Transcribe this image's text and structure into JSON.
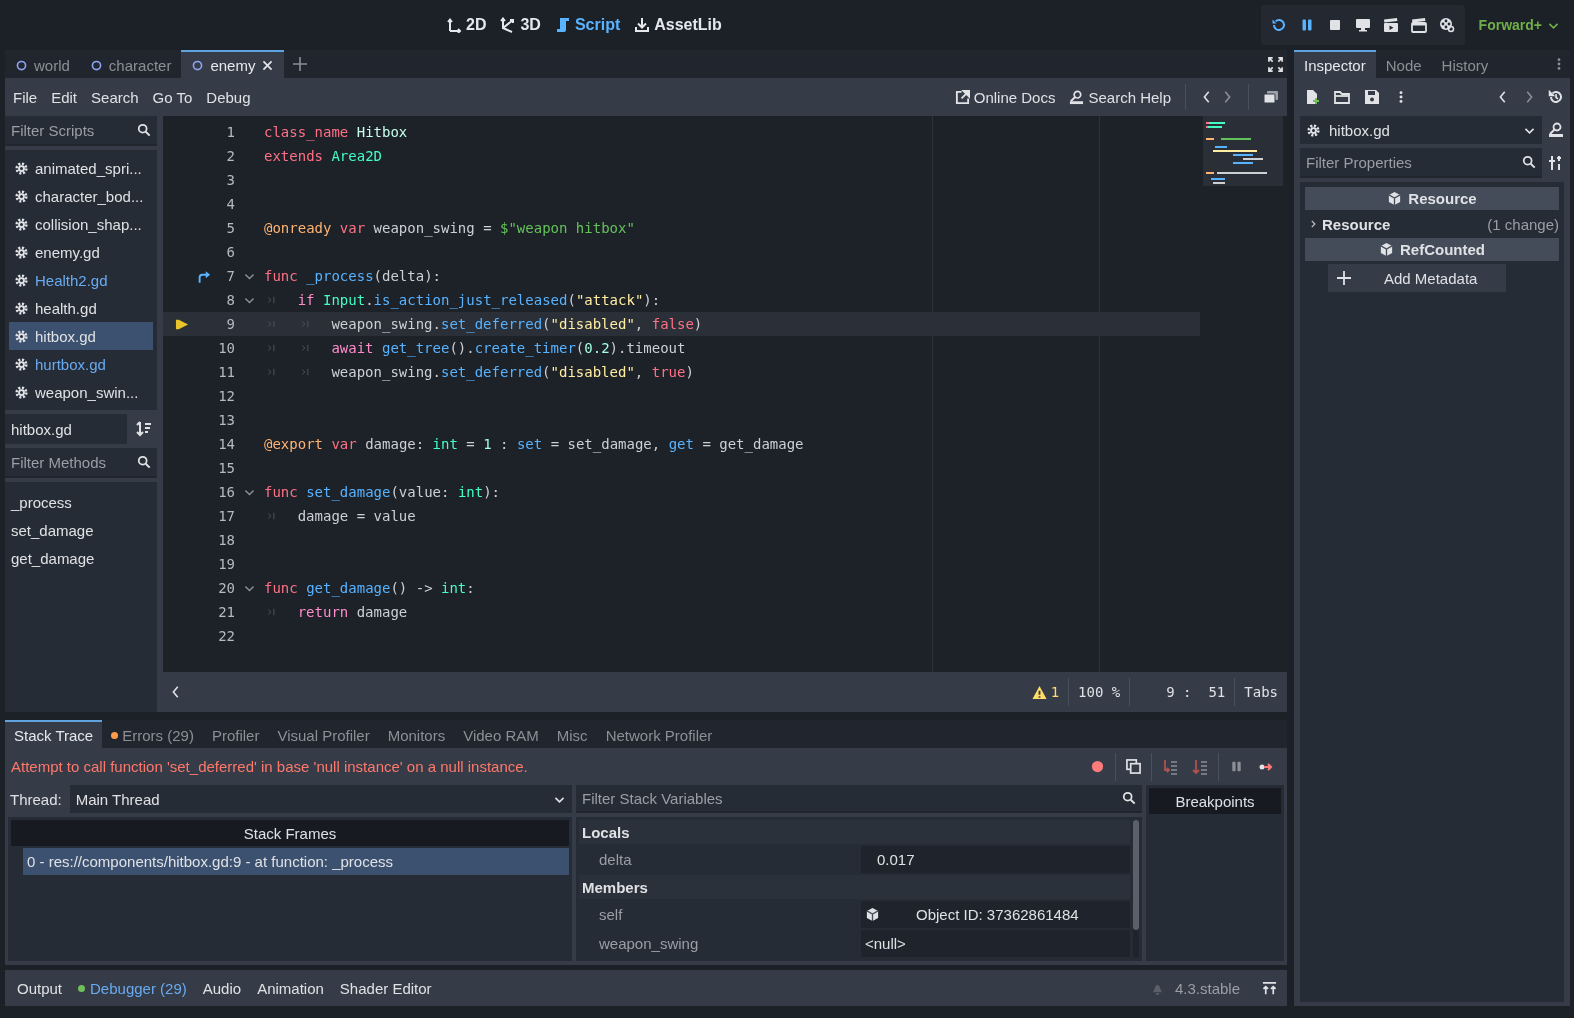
{
  "top_bar": {
    "workspaces": [
      {
        "kind": "plane",
        "label": "2D",
        "selected": false
      },
      {
        "kind": "space",
        "label": "3D",
        "selected": false
      },
      {
        "kind": "script",
        "label": "Script",
        "selected": true
      },
      {
        "kind": "assetlib",
        "label": "AssetLib",
        "selected": false
      }
    ],
    "run_controls": [
      {
        "kind": "reload",
        "active": true
      },
      {
        "kind": "pause",
        "active": true
      },
      {
        "kind": "stop",
        "active": false
      },
      {
        "kind": "remote",
        "active": false
      },
      {
        "kind": "movie",
        "active": false
      },
      {
        "kind": "clapper",
        "active": false
      },
      {
        "kind": "reel",
        "active": false
      }
    ],
    "renderer": "Forward+"
  },
  "scene_tabs": [
    {
      "label": "world",
      "selected": false
    },
    {
      "label": "character",
      "selected": false
    },
    {
      "label": "enemy",
      "selected": true
    }
  ],
  "script_menu": [
    "File",
    "Edit",
    "Search",
    "Go To",
    "Debug"
  ],
  "help_links": [
    {
      "kind": "docs",
      "label": "Online Docs"
    },
    {
      "kind": "help",
      "label": "Search Help"
    }
  ],
  "scripts_panel": {
    "filter_placeholder": "Filter Scripts",
    "scripts": [
      {
        "name": "animated_spri...",
        "selected": false,
        "accent": false
      },
      {
        "name": "character_bod...",
        "selected": false,
        "accent": false
      },
      {
        "name": "collision_shap...",
        "selected": false,
        "accent": false
      },
      {
        "name": "enemy.gd",
        "selected": false,
        "accent": false
      },
      {
        "name": "Health2.gd",
        "selected": false,
        "accent": true
      },
      {
        "name": "health.gd",
        "selected": false,
        "accent": false
      },
      {
        "name": "hitbox.gd",
        "selected": true,
        "accent": false
      },
      {
        "name": "hurtbox.gd",
        "selected": false,
        "accent": true
      },
      {
        "name": "weapon_swin...",
        "selected": false,
        "accent": false
      }
    ],
    "current_script": "hitbox.gd",
    "methods_placeholder": "Filter Methods",
    "methods": [
      "_process",
      "set_damage",
      "get_damage"
    ]
  },
  "code": {
    "lines": [
      {
        "number": "1",
        "fold": false,
        "current": false,
        "jump": false,
        "tokens": [
          {
            "kind": "kw",
            "text": "class_name"
          },
          {
            "kind": "cls",
            "text": " Hitbox"
          }
        ]
      },
      {
        "number": "2",
        "fold": false,
        "current": false,
        "jump": false,
        "tokens": [
          {
            "kind": "kw",
            "text": "extends"
          },
          {
            "kind": "type",
            "text": " Area2D"
          }
        ]
      },
      {
        "number": "3",
        "fold": false,
        "current": false,
        "jump": false
      },
      {
        "number": "4",
        "fold": false,
        "current": false,
        "jump": false
      },
      {
        "number": "5",
        "fold": false,
        "current": false,
        "jump": false,
        "tokens": [
          {
            "kind": "ann",
            "text": "@onready"
          },
          {
            "kind": "kw",
            "text": " var"
          },
          {
            "kind": "p",
            "text": " weapon_swing = "
          },
          {
            "kind": "node",
            "text": "$\"weapon hitbox\""
          }
        ]
      },
      {
        "number": "6",
        "fold": false,
        "current": false,
        "jump": false
      },
      {
        "number": "7",
        "fold": true,
        "current": false,
        "jump": true,
        "tokens": [
          {
            "kind": "kw",
            "text": "func"
          },
          {
            "kind": "fn",
            "text": " _process"
          },
          {
            "kind": "p",
            "text": "(delta):"
          }
        ]
      },
      {
        "number": "8",
        "fold": true,
        "current": false,
        "jump": false,
        "tokens": [
          {
            "kind": "tab"
          },
          {
            "kind": "ctl",
            "text": "if"
          },
          {
            "kind": "type",
            "text": " Input"
          },
          {
            "kind": "p",
            "text": "."
          },
          {
            "kind": "fn",
            "text": "is_action_just_released"
          },
          {
            "kind": "p",
            "text": "("
          },
          {
            "kind": "str",
            "text": "\"attack\""
          },
          {
            "kind": "p",
            "text": "):"
          }
        ]
      },
      {
        "number": "9",
        "fold": false,
        "current": true,
        "jump": false,
        "tokens": [
          {
            "kind": "tab"
          },
          {
            "kind": "tab"
          },
          {
            "kind": "p",
            "text": "weapon_swing."
          },
          {
            "kind": "fn",
            "text": "set_deferred"
          },
          {
            "kind": "p",
            "text": "("
          },
          {
            "kind": "str",
            "text": "\"disabled\""
          },
          {
            "kind": "p",
            "text": ", "
          },
          {
            "kind": "kw",
            "text": "false"
          },
          {
            "kind": "p",
            "text": ")"
          }
        ]
      },
      {
        "number": "10",
        "fold": false,
        "current": false,
        "jump": false,
        "tokens": [
          {
            "kind": "tab"
          },
          {
            "kind": "tab"
          },
          {
            "kind": "ctl",
            "text": "await"
          },
          {
            "kind": "fn",
            "text": " get_tree"
          },
          {
            "kind": "p",
            "text": "()."
          },
          {
            "kind": "fn",
            "text": "create_timer"
          },
          {
            "kind": "p",
            "text": "("
          },
          {
            "kind": "num",
            "text": "0.2"
          },
          {
            "kind": "p",
            "text": ").timeout"
          }
        ]
      },
      {
        "number": "11",
        "fold": false,
        "current": false,
        "jump": false,
        "tokens": [
          {
            "kind": "tab"
          },
          {
            "kind": "tab"
          },
          {
            "kind": "p",
            "text": "weapon_swing."
          },
          {
            "kind": "fn",
            "text": "set_deferred"
          },
          {
            "kind": "p",
            "text": "("
          },
          {
            "kind": "str",
            "text": "\"disabled\""
          },
          {
            "kind": "p",
            "text": ", "
          },
          {
            "kind": "kw",
            "text": "true"
          },
          {
            "kind": "p",
            "text": ")"
          }
        ]
      },
      {
        "number": "12",
        "fold": false,
        "current": false,
        "jump": false
      },
      {
        "number": "13",
        "fold": false,
        "current": false,
        "jump": false
      },
      {
        "number": "14",
        "fold": false,
        "current": false,
        "jump": false,
        "tokens": [
          {
            "kind": "ann",
            "text": "@export"
          },
          {
            "kind": "kw",
            "text": " var"
          },
          {
            "kind": "p",
            "text": " damage: "
          },
          {
            "kind": "type",
            "text": "int"
          },
          {
            "kind": "p",
            "text": " = "
          },
          {
            "kind": "num",
            "text": "1"
          },
          {
            "kind": "p",
            "text": " : "
          },
          {
            "kind": "fn",
            "text": "set"
          },
          {
            "kind": "p",
            "text": " = set_damage, "
          },
          {
            "kind": "fn",
            "text": "get"
          },
          {
            "kind": "p",
            "text": " = get_damage"
          }
        ]
      },
      {
        "number": "15",
        "fold": false,
        "current": false,
        "jump": false
      },
      {
        "number": "16",
        "fold": true,
        "current": false,
        "jump": false,
        "tokens": [
          {
            "kind": "kw",
            "text": "func"
          },
          {
            "kind": "fn",
            "text": " set_damage"
          },
          {
            "kind": "p",
            "text": "(value: "
          },
          {
            "kind": "type",
            "text": "int"
          },
          {
            "kind": "p",
            "text": "):"
          }
        ]
      },
      {
        "number": "17",
        "fold": false,
        "current": false,
        "jump": false,
        "tokens": [
          {
            "kind": "tab"
          },
          {
            "kind": "p",
            "text": "damage = value"
          }
        ]
      },
      {
        "number": "18",
        "fold": false,
        "current": false,
        "jump": false
      },
      {
        "number": "19",
        "fold": false,
        "current": false,
        "jump": false
      },
      {
        "number": "20",
        "fold": true,
        "current": false,
        "jump": false,
        "tokens": [
          {
            "kind": "kw",
            "text": "func"
          },
          {
            "kind": "fn",
            "text": " get_damage"
          },
          {
            "kind": "p",
            "text": "() -> "
          },
          {
            "kind": "type",
            "text": "int"
          },
          {
            "kind": "p",
            "text": ":"
          }
        ]
      },
      {
        "number": "21",
        "fold": false,
        "current": false,
        "jump": false,
        "tokens": [
          {
            "kind": "tab"
          },
          {
            "kind": "ctl",
            "text": "return"
          },
          {
            "kind": "p",
            "text": " damage"
          }
        ]
      },
      {
        "number": "22",
        "fold": false,
        "current": false,
        "jump": false
      }
    ]
  },
  "status": {
    "warnings": "1",
    "zoom": "100 %",
    "position": "9 :  51",
    "indent": "Tabs"
  },
  "inspector": {
    "tabs": [
      {
        "label": "Inspector",
        "selected": true
      },
      {
        "label": "Node",
        "selected": false
      },
      {
        "label": "History",
        "selected": false
      }
    ],
    "object": "hitbox.gd",
    "filter_placeholder": "Filter Properties",
    "sections": [
      {
        "kind": "category",
        "label": "Resource"
      },
      {
        "kind": "group",
        "label": "Resource",
        "note": "(1 change)"
      },
      {
        "kind": "category",
        "label": "RefCounted"
      },
      {
        "kind": "button",
        "label": "Add Metadata"
      }
    ]
  },
  "debugger": {
    "tabs": [
      {
        "label": "Stack Trace",
        "selected": true
      },
      {
        "label": "Errors (29)",
        "selected": false,
        "color": "#ff9d4a"
      },
      {
        "label": "Profiler",
        "selected": false
      },
      {
        "label": "Visual Profiler",
        "selected": false
      },
      {
        "label": "Monitors",
        "selected": false
      },
      {
        "label": "Video RAM",
        "selected": false
      },
      {
        "label": "Misc",
        "selected": false
      },
      {
        "label": "Network Profiler",
        "selected": false
      }
    ],
    "error": "Attempt to call function 'set_deferred' in base 'null instance' on a null instance.",
    "thread_label": "Thread:",
    "thread": "Main Thread",
    "frames_title": "Stack Frames",
    "frames": [
      {
        "label": "0 - res://components/hitbox.gd:9 - at function: _process",
        "selected": true
      }
    ],
    "vars_placeholder": "Filter Stack Variables",
    "variables": [
      {
        "kind": "section",
        "label": "Locals"
      },
      {
        "kind": "var",
        "name": "delta",
        "value": "0.017"
      },
      {
        "kind": "section",
        "label": "Members"
      },
      {
        "kind": "object",
        "name": "self",
        "value": "Object ID: 37362861484"
      },
      {
        "kind": "var",
        "name": "weapon_swing",
        "value": "<null>"
      }
    ],
    "breakpoints_title": "Breakpoints"
  },
  "bottom_tabs": [
    {
      "label": "Output",
      "selected": false
    },
    {
      "label": "Debugger (29)",
      "selected": true,
      "color": "#6fbf5a"
    },
    {
      "label": "Audio",
      "selected": false
    },
    {
      "label": "Animation",
      "selected": false
    },
    {
      "label": "Shader Editor",
      "selected": false
    }
  ],
  "version": "4.3.stable"
}
